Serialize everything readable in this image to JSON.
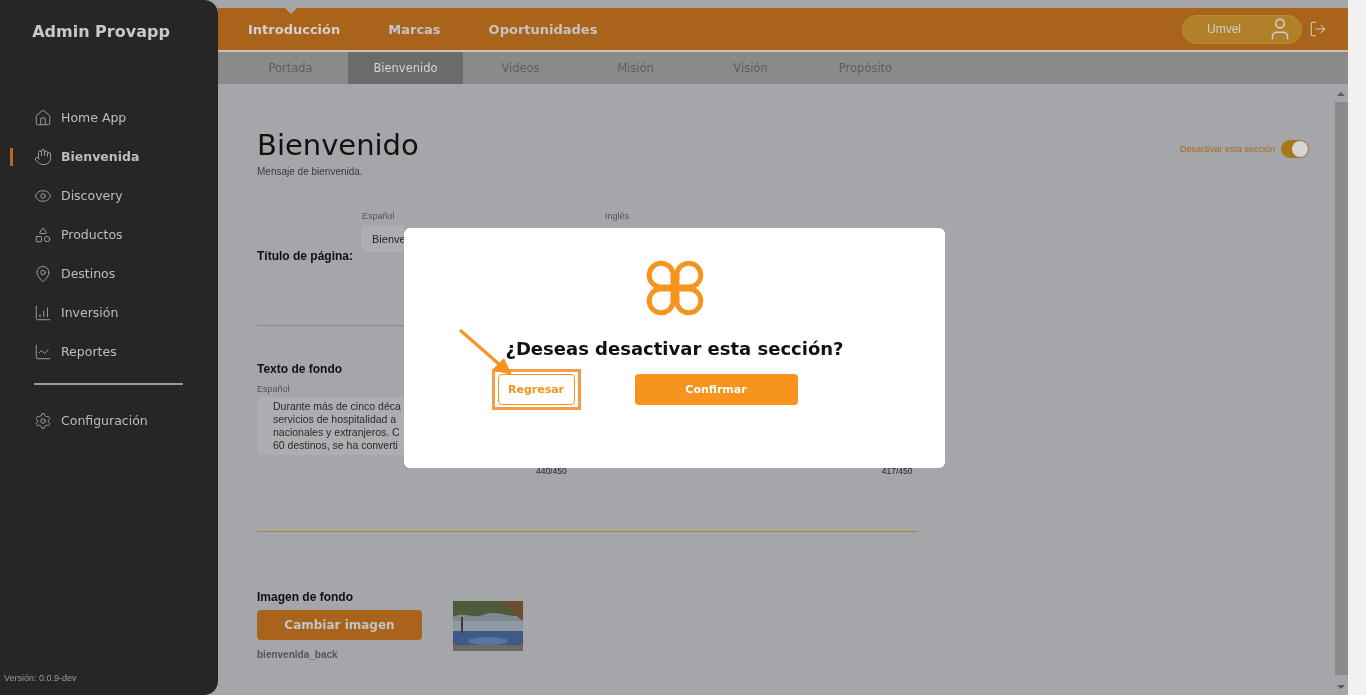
{
  "sidebar": {
    "title": "Admin Provapp",
    "items": [
      {
        "label": "Home App",
        "selected": false
      },
      {
        "label": "Bienvenida",
        "selected": true
      },
      {
        "label": "Discovery",
        "selected": false
      },
      {
        "label": "Productos",
        "selected": false
      },
      {
        "label": "Destinos",
        "selected": false
      },
      {
        "label": "Inversión",
        "selected": false
      },
      {
        "label": "Reportes",
        "selected": false
      }
    ],
    "settings": {
      "label": "Configuración",
      "selected": false
    },
    "version": "Versión: 0.0.9-dev"
  },
  "top_tabs": [
    {
      "label": "Introducción",
      "selected": true
    },
    {
      "label": "Marcas",
      "selected": false
    },
    {
      "label": "Oportunidades",
      "selected": false
    }
  ],
  "user": {
    "name": "Umvel"
  },
  "sub_tabs": [
    {
      "label": "Portada",
      "selected": false
    },
    {
      "label": "Bienvenido",
      "selected": true
    },
    {
      "label": "Videos",
      "selected": false
    },
    {
      "label": "Misión",
      "selected": false
    },
    {
      "label": "Visión",
      "selected": false
    },
    {
      "label": "Propósito",
      "selected": false
    }
  ],
  "page": {
    "title": "Bienvenido",
    "subtitle": "Mensaje de bienvenida.",
    "section_toggle": {
      "label": "Desactivar esta sección",
      "on": true
    },
    "title_field": {
      "label": "Título de página:",
      "spanish_label": "Español",
      "english_label": "Inglés",
      "spanish_value": "Bienve"
    },
    "background_text": {
      "label": "Texto de fondo",
      "spanish_label": "Español",
      "spanish_lines": [
        "Durante más de cinco déca",
        "servicios de hospitalidad a",
        "nacionales y extranjeros. C",
        "60 destinos, se ha converti"
      ],
      "spanish_count": "440/450",
      "english_count": "417/450"
    },
    "background_image": {
      "label": "Imagen de fondo",
      "button": "Cambiar imagen",
      "filename": "bienvenida_back"
    }
  },
  "dialog": {
    "question": "¿Deseas desactivar esta sección?",
    "buttons": [
      {
        "label": "Regresar",
        "kind": "outline",
        "highlighted": true
      },
      {
        "label": "Confirmar",
        "kind": "filled",
        "highlighted": false
      }
    ]
  }
}
